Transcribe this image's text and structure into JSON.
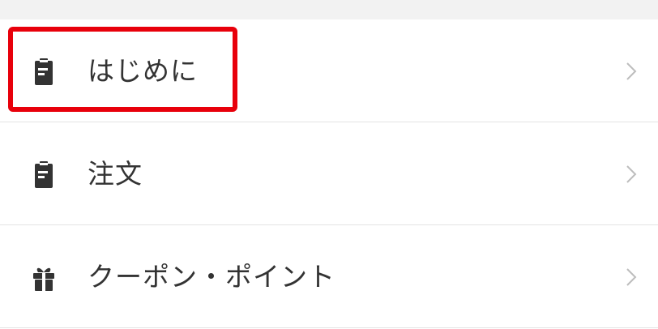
{
  "menu": {
    "items": [
      {
        "label": "はじめに",
        "icon": "document-icon"
      },
      {
        "label": "注文",
        "icon": "document-icon"
      },
      {
        "label": "クーポン・ポイント",
        "icon": "gift-icon"
      }
    ]
  },
  "colors": {
    "highlight": "#e8000b",
    "icon": "#333333",
    "chevron": "#bdbdbd",
    "divider": "#e3e3e3"
  }
}
